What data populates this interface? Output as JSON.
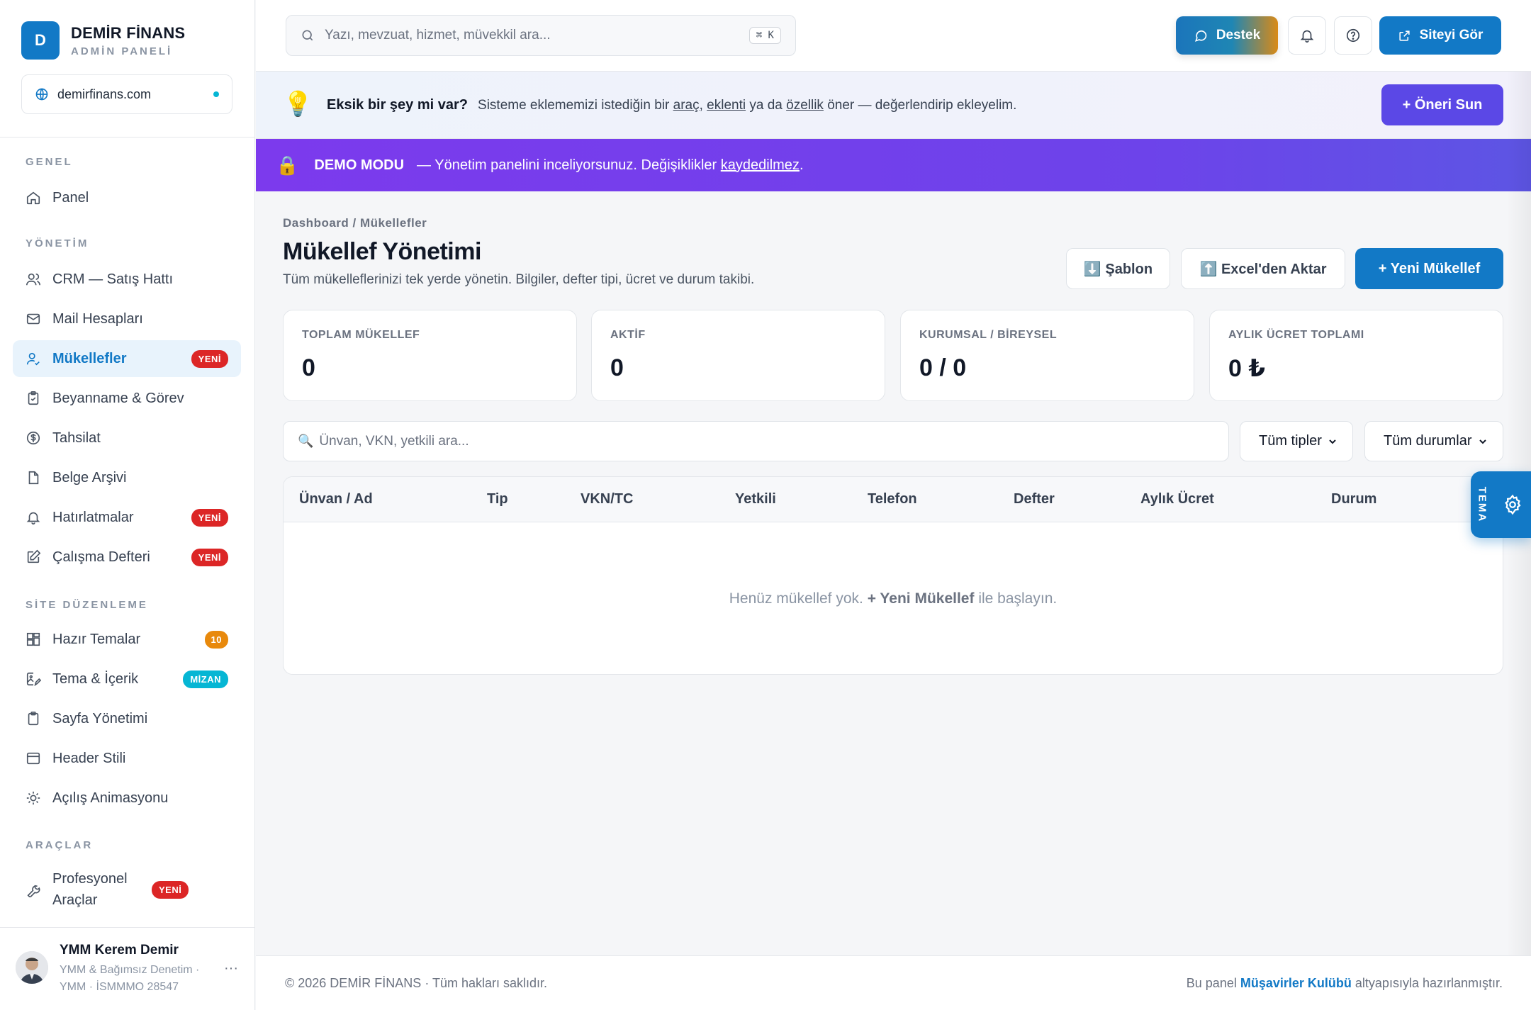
{
  "brand": {
    "initial": "D",
    "name": "DEMİR FİNANS",
    "subtitle": "ADMİN PANELİ",
    "domain": "demirfinans.com"
  },
  "sidebar": {
    "sections": [
      {
        "title": "GENEL"
      },
      {
        "title": "YÖNETİM"
      },
      {
        "title": "SİTE DÜZENLEME"
      },
      {
        "title": "ARAÇLAR"
      }
    ],
    "items": [
      {
        "label": "Panel",
        "icon": "home-icon"
      },
      {
        "label": "CRM — Satış Hattı",
        "icon": "users-icon"
      },
      {
        "label": "Mail Hesapları",
        "icon": "mail-icon"
      },
      {
        "label": "Mükellefler",
        "icon": "user-group-icon",
        "badge": "YENİ",
        "active": true
      },
      {
        "label": "Beyanname & Görev",
        "icon": "clipboard-icon"
      },
      {
        "label": "Tahsilat",
        "icon": "dollar-icon"
      },
      {
        "label": "Belge Arşivi",
        "icon": "file-icon"
      },
      {
        "label": "Hatırlatmalar",
        "icon": "bell-icon",
        "badge": "YENİ"
      },
      {
        "label": "Çalışma Defteri",
        "icon": "edit-icon",
        "badge": "YENİ"
      },
      {
        "label": "Hazır Temalar",
        "icon": "grid-icon",
        "badge": "10"
      },
      {
        "label": "Tema & İçerik",
        "icon": "image-edit-icon",
        "badge": "MİZAN"
      },
      {
        "label": "Sayfa Yönetimi",
        "icon": "clipboard-list-icon"
      },
      {
        "label": "Header Stili",
        "icon": "layout-icon"
      },
      {
        "label": "Açılış Animasyonu",
        "icon": "sun-icon"
      },
      {
        "label": "Profesyonel Araçlar",
        "icon": "wrench-icon",
        "badge": "YENİ"
      }
    ]
  },
  "user": {
    "name": "YMM Kerem Demir",
    "line1": "YMM & Bağımsız Denetim ·",
    "line2": "YMM · İSMMMO 28547",
    "more": "···"
  },
  "topbar": {
    "search_placeholder": "Yazı, mevzuat, hizmet, müvekkil ara...",
    "shortcut": "⌘ K",
    "support_label": "Destek",
    "view_site_label": "Siteyi Gör"
  },
  "suggestion": {
    "emoji": "💡",
    "title": "Eksik bir şey mi var?",
    "text_1": "Sisteme eklememizi istediğin bir",
    "link_1": "araç",
    "sep": ",",
    "link_2": "eklenti",
    "text_2": "ya da",
    "link_3": "özellik",
    "text_3": "öner — değerlendirip ekleyelim.",
    "button": "+ Öneri Sun"
  },
  "demo": {
    "lock": "🔒",
    "title": "DEMO MODU",
    "text": "— Yönetim panelini inceliyorsunuz. Değişiklikler",
    "link": "kaydedilmez",
    "period": "."
  },
  "page": {
    "breadcrumb": "Dashboard / Mükellefler",
    "title": "Mükellef Yönetimi",
    "description": "Tüm mükelleflerinizi tek yerde yönetin. Bilgiler, defter tipi, ücret ve durum takibi.",
    "template_button": "⬇️ Şablon",
    "import_button": "⬆️ Excel'den Aktar",
    "new_button": "+ Yeni Mükellef"
  },
  "stats": [
    {
      "label": "TOPLAM MÜKELLEF",
      "value": "0"
    },
    {
      "label": "AKTİF",
      "value": "0"
    },
    {
      "label": "KURUMSAL / BİREYSEL",
      "value": "0 / 0"
    },
    {
      "label": "AYLIK ÜCRET TOPLAMI",
      "value": "0 ₺"
    }
  ],
  "filters": {
    "search_emoji": "🔍",
    "search_placeholder": "Ünvan, VKN, yetkili ara...",
    "type_selected": "Tüm tipler",
    "status_selected": "Tüm durumlar"
  },
  "table": {
    "columns": [
      "Ünvan / Ad",
      "Tip",
      "VKN/TC",
      "Yetkili",
      "Telefon",
      "Defter",
      "Aylık Ücret",
      "Durum"
    ],
    "empty_before": "Henüz mükellef yok.",
    "empty_action": "+ Yeni Mükellef",
    "empty_after": "ile başlayın."
  },
  "theme_tab": {
    "label": "TEMA"
  },
  "footer": {
    "left": "© 2026 DEMİR FİNANS · Tüm hakları saklıdır.",
    "right_before": "Bu panel",
    "right_link": "Müşavirler Kulübü",
    "right_after": "altyapısıyla hazırlanmıştır."
  },
  "colors": {
    "primary": "#1279c6",
    "badge_red": "#dc2626",
    "badge_orange": "#e8890c",
    "badge_cyan": "#06b6d4",
    "demo_purple": "#7c3aed",
    "suggest_button": "#5b48e6"
  }
}
